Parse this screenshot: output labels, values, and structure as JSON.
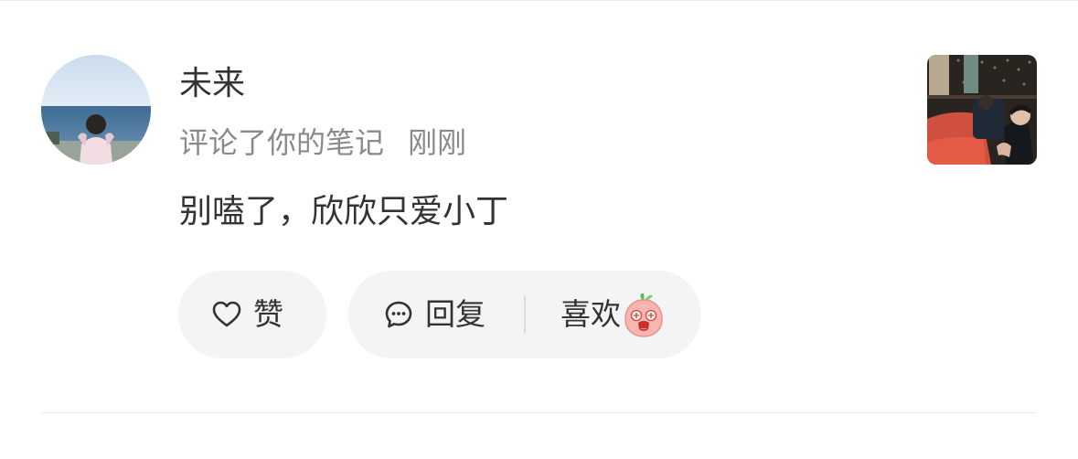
{
  "notification": {
    "username": "未来",
    "action_text": "评论了你的笔记",
    "time": "刚刚",
    "comment_text": "别嗑了，欣欣只爱小丁"
  },
  "actions": {
    "like_label": "赞",
    "reply_label": "回复",
    "love_label": "喜欢"
  },
  "icons": {
    "like": "heart-outline-icon",
    "reply": "chat-bubble-icon",
    "love": "peach-emoji-icon"
  },
  "colors": {
    "pill_background": "#f4f4f6",
    "text_primary": "#333333",
    "text_secondary": "#8a8a8a",
    "divider": "#ececec"
  }
}
